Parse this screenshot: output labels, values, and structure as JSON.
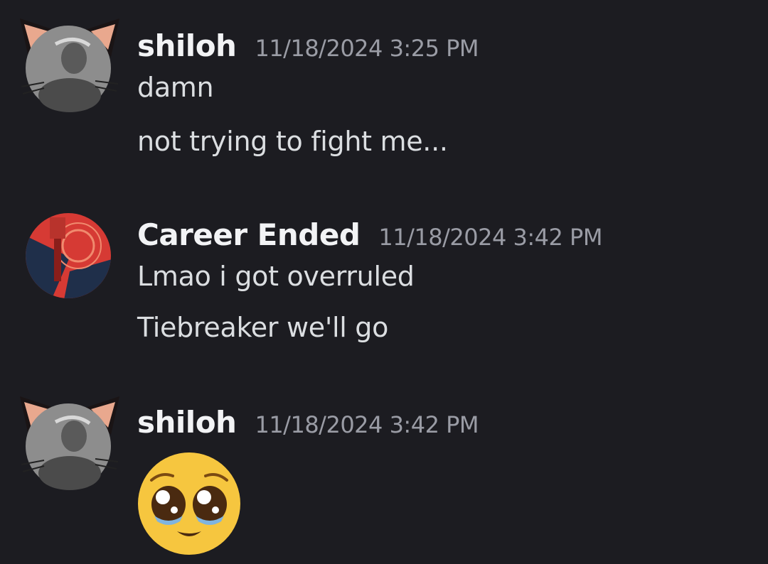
{
  "messages": [
    {
      "author": "shiloh",
      "timestamp": "11/18/2024 3:25 PM",
      "avatar_icon": "cat-ear-avatar-icon",
      "lines": [
        "damn",
        "not trying to fight me..."
      ]
    },
    {
      "author": "Career Ended",
      "timestamp": "11/18/2024 3:42 PM",
      "avatar_icon": "red-art-avatar-icon",
      "lines": [
        "Lmao i got overruled",
        "Tiebreaker we'll go"
      ]
    },
    {
      "author": "shiloh",
      "timestamp": "11/18/2024 3:42 PM",
      "avatar_icon": "cat-ear-avatar-icon",
      "emoji": "pleading-face-emoji"
    }
  ],
  "colors": {
    "background": "#1c1c21",
    "username": "#f2f3f5",
    "timestamp": "#9a9ca5",
    "message_text": "#dbdee1"
  }
}
